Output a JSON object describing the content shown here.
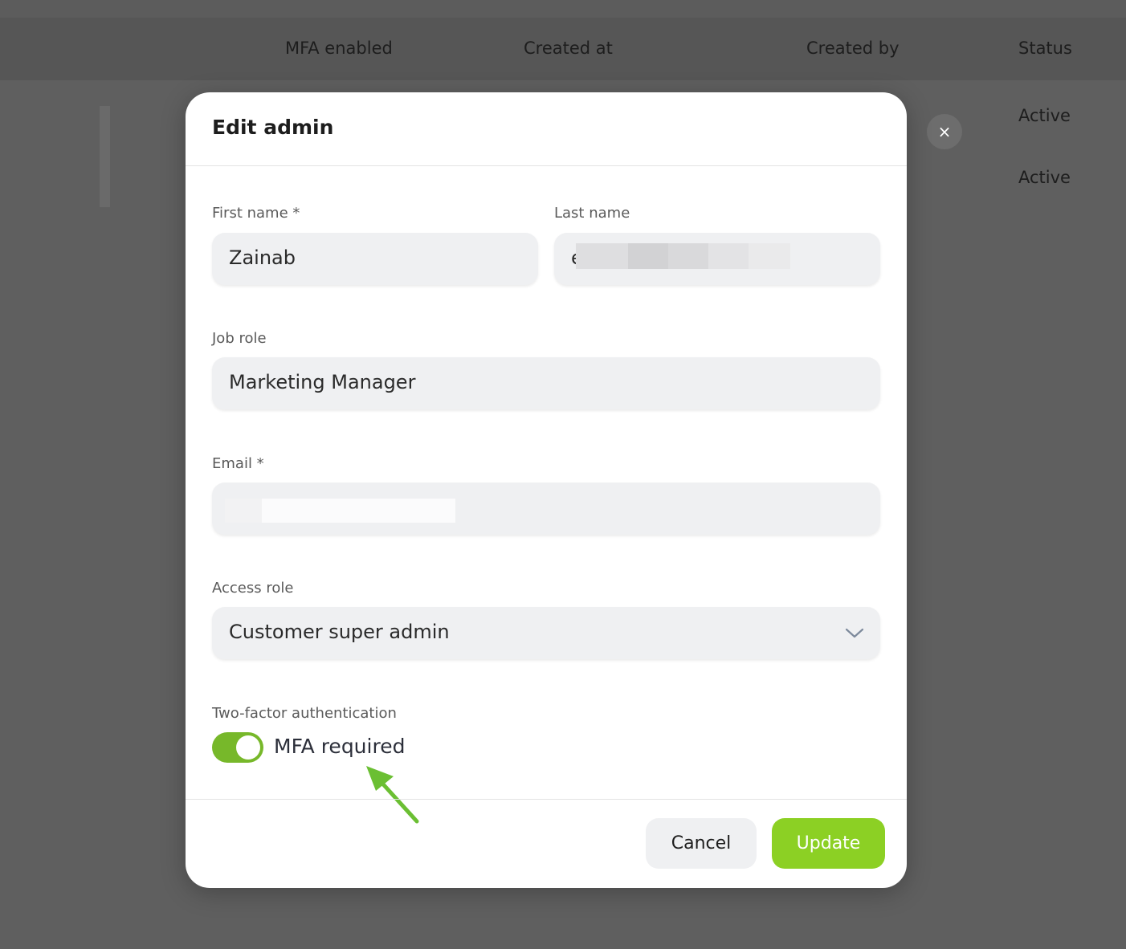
{
  "background": {
    "table_headers": [
      "MFA enabled",
      "Created at",
      "Created by",
      "Status"
    ],
    "status_values": [
      "Active",
      "Active"
    ],
    "close_icon": "×"
  },
  "modal": {
    "title": "Edit admin",
    "first_name": {
      "label": "First name *",
      "value": "Zainab"
    },
    "last_name": {
      "label": "Last name",
      "value_visible_prefix": "e"
    },
    "job_role": {
      "label": "Job role",
      "value": "Marketing Manager"
    },
    "email": {
      "label": "Email *"
    },
    "access_role": {
      "label": "Access role",
      "value": "Customer super admin",
      "icon": "chevron-down-icon"
    },
    "two_factor": {
      "label": "Two-factor authentication",
      "toggle_label": "MFA required",
      "enabled": true
    },
    "buttons": {
      "cancel": "Cancel",
      "update": "Update"
    }
  },
  "colors": {
    "overlay": "#5f5f5f",
    "toggle_on": "#77b82a",
    "update_button": "#8cd024",
    "annotation_arrow": "#6bbf33"
  }
}
